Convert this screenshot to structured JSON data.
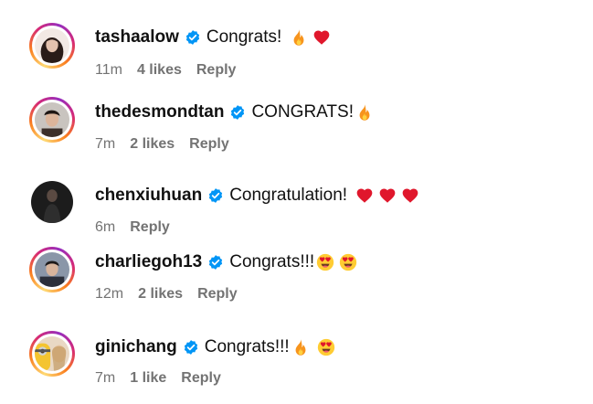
{
  "colors": {
    "verified_blue": "#0095f6",
    "meta_gray": "#737373",
    "heart_red": "#e0172c",
    "fire_orange": "#f7941d"
  },
  "comments": [
    {
      "username": "tashaalow",
      "text": "Congrats!",
      "emojis": [
        "fire-icon",
        "red-heart-icon"
      ],
      "time": "11m",
      "likes": "4 likes",
      "reply": "Reply",
      "avatar_ring": true
    },
    {
      "username": "thedesmondtan",
      "text": "CONGRATS!",
      "emojis": [
        "fire-icon"
      ],
      "time": "7m",
      "likes": "2 likes",
      "reply": "Reply",
      "avatar_ring": true
    },
    {
      "username": "chenxiuhuan",
      "text": "Congratulation!",
      "emojis": [
        "red-heart-icon",
        "red-heart-icon",
        "red-heart-icon"
      ],
      "time": "6m",
      "likes": "",
      "reply": "Reply",
      "avatar_ring": false
    },
    {
      "username": "charliegoh13",
      "text": "Congrats!!!",
      "emojis": [
        "heart-eyes-icon",
        "heart-eyes-icon"
      ],
      "time": "12m",
      "likes": "2 likes",
      "reply": "Reply",
      "avatar_ring": true
    },
    {
      "username": "ginichang",
      "text": "Congrats!!!",
      "emojis": [
        "fire-icon",
        "heart-eyes-icon"
      ],
      "time": "7m",
      "likes": "1 like",
      "reply": "Reply",
      "avatar_ring": true
    }
  ]
}
